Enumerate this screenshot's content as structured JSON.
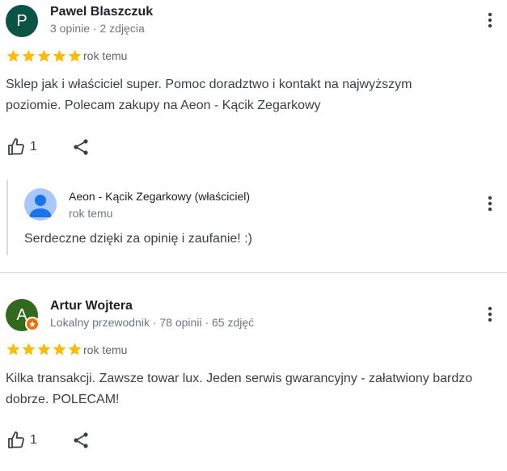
{
  "reviews": [
    {
      "avatar_letter": "P",
      "avatar_color": "#0b5345",
      "author": "Pawel Blaszczuk",
      "meta": "3 opinie · 2 zdjęcia",
      "rating": 5,
      "time": "rok temu",
      "text": "Sklep jak i właściciel super. Pomoc doradztwo i kontakt na najwyższym poziomie. Polecam zakupy na Aeon - Kącik Zegarkowy",
      "likes": "1",
      "reply": {
        "owner": "Aeon - Kącik Zegarkowy (właściciel)",
        "time": "rok temu",
        "text": "Serdeczne dzięki za opinię i zaufanie! :)"
      }
    },
    {
      "avatar_letter": "A",
      "avatar_color": "#33691e",
      "author": "Artur Wojtera",
      "meta": "Lokalny przewodnik · 78 opinii · 65 zdjęć",
      "rating": 5,
      "time": "rok temu",
      "text": "Kilka transakcji. Zawsze towar lux. Jeden serwis gwarancyjny - załatwiony bardzo dobrze. POLECAM!",
      "likes": "1"
    }
  ],
  "colors": {
    "star": "#fbbc04",
    "icon": "#3c4043",
    "owner_avatar": "#a8c7fa",
    "badge": "#e8710a"
  },
  "icons": {
    "like": "thumb-up-outline",
    "share": "share-icon",
    "more": "vertical-dots"
  }
}
